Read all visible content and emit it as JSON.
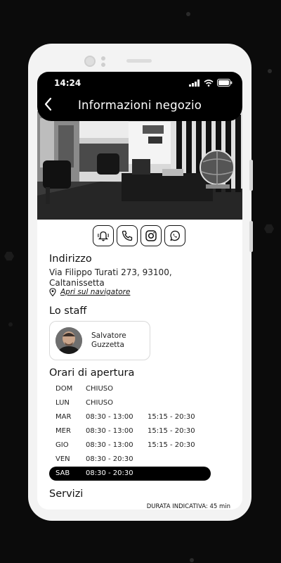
{
  "status": {
    "time": "14:24"
  },
  "header": {
    "title": "Informazioni negozio"
  },
  "social": [
    {
      "name": "bell-icon"
    },
    {
      "name": "phone-icon"
    },
    {
      "name": "instagram-icon"
    },
    {
      "name": "whatsapp-icon"
    }
  ],
  "address": {
    "heading": "Indirizzo",
    "line1": "Via Filippo Turati 273, 93100,",
    "line2": "Caltanissetta",
    "navigator_link": "Apri sul navigatore"
  },
  "staff": {
    "heading": "Lo staff",
    "members": [
      {
        "first": "Salvatore",
        "last": "Guzzetta"
      }
    ]
  },
  "hours": {
    "heading": "Orari di apertura",
    "rows": [
      {
        "day": "DOM",
        "morning": "CHIUSO",
        "afternoon": ""
      },
      {
        "day": "LUN",
        "morning": "CHIUSO",
        "afternoon": ""
      },
      {
        "day": "MAR",
        "morning": "08:30 - 13:00",
        "afternoon": "15:15 - 20:30"
      },
      {
        "day": "MER",
        "morning": "08:30 - 13:00",
        "afternoon": "15:15 - 20:30"
      },
      {
        "day": "GIO",
        "morning": "08:30 - 13:00",
        "afternoon": "15:15 - 20:30"
      },
      {
        "day": "VEN",
        "morning": "08:30 - 20:30",
        "afternoon": ""
      },
      {
        "day": "SAB",
        "morning": "08:30 - 20:30",
        "afternoon": "",
        "active": true
      }
    ]
  },
  "services": {
    "heading": "Servizi",
    "duration_note": "DURATA INDICATIVA: 45 min"
  },
  "colors": {
    "accent": "#000000",
    "background": "#0b0b0b",
    "device": "#f3f3f3"
  }
}
